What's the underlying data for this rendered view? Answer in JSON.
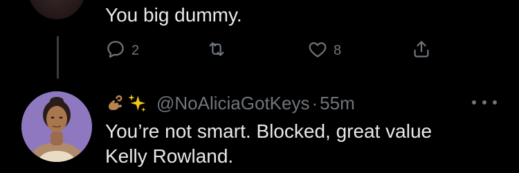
{
  "tweet1": {
    "text": "You big dummy.",
    "actions": {
      "reply_count": "2",
      "retweet_count": "",
      "like_count": "8"
    }
  },
  "tweet2": {
    "emoji": [
      "pinching-hand-emoji",
      "sparkles-emoji"
    ],
    "handle": "@NoAliciaGotKeys",
    "separator": "·",
    "time": "55m",
    "text_line1": "You’re not smart. Blocked, great value",
    "text_line2": "Kelly Rowland."
  },
  "icons": {
    "reply": "reply-icon",
    "retweet": "retweet-icon",
    "like": "heart-icon",
    "share": "share-icon",
    "more": "more-icon"
  },
  "colors": {
    "background": "#000000",
    "text": "#e7e9ea",
    "muted": "#6e767d",
    "avatar_bg": "#8e79c0"
  }
}
